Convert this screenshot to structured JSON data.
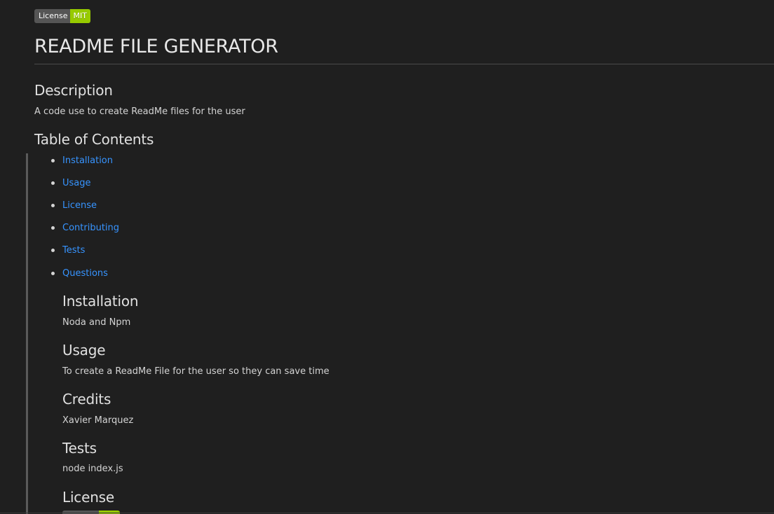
{
  "badge": {
    "label": "License",
    "value": "MIT"
  },
  "title": "README FILE GENERATOR",
  "description": {
    "heading": "Description",
    "text": "A code use to create ReadMe files for the user"
  },
  "toc": {
    "heading": "Table of Contents",
    "items": [
      {
        "label": "Installation"
      },
      {
        "label": "Usage"
      },
      {
        "label": "License"
      },
      {
        "label": "Contributing"
      },
      {
        "label": "Tests"
      },
      {
        "label": "Questions"
      }
    ]
  },
  "sections": {
    "installation": {
      "heading": "Installation",
      "text": "Noda and Npm"
    },
    "usage": {
      "heading": "Usage",
      "text": "To create a ReadMe File for the user so they can save time"
    },
    "credits": {
      "heading": "Credits",
      "text": "Xavier Marquez"
    },
    "tests": {
      "heading": "Tests",
      "text": "node index.js"
    },
    "license": {
      "heading": "License"
    }
  },
  "colors": {
    "background": "#1f1f1f",
    "link": "#3794ff",
    "badge_label_bg": "#555555",
    "badge_value_bg": "#97ca00"
  }
}
